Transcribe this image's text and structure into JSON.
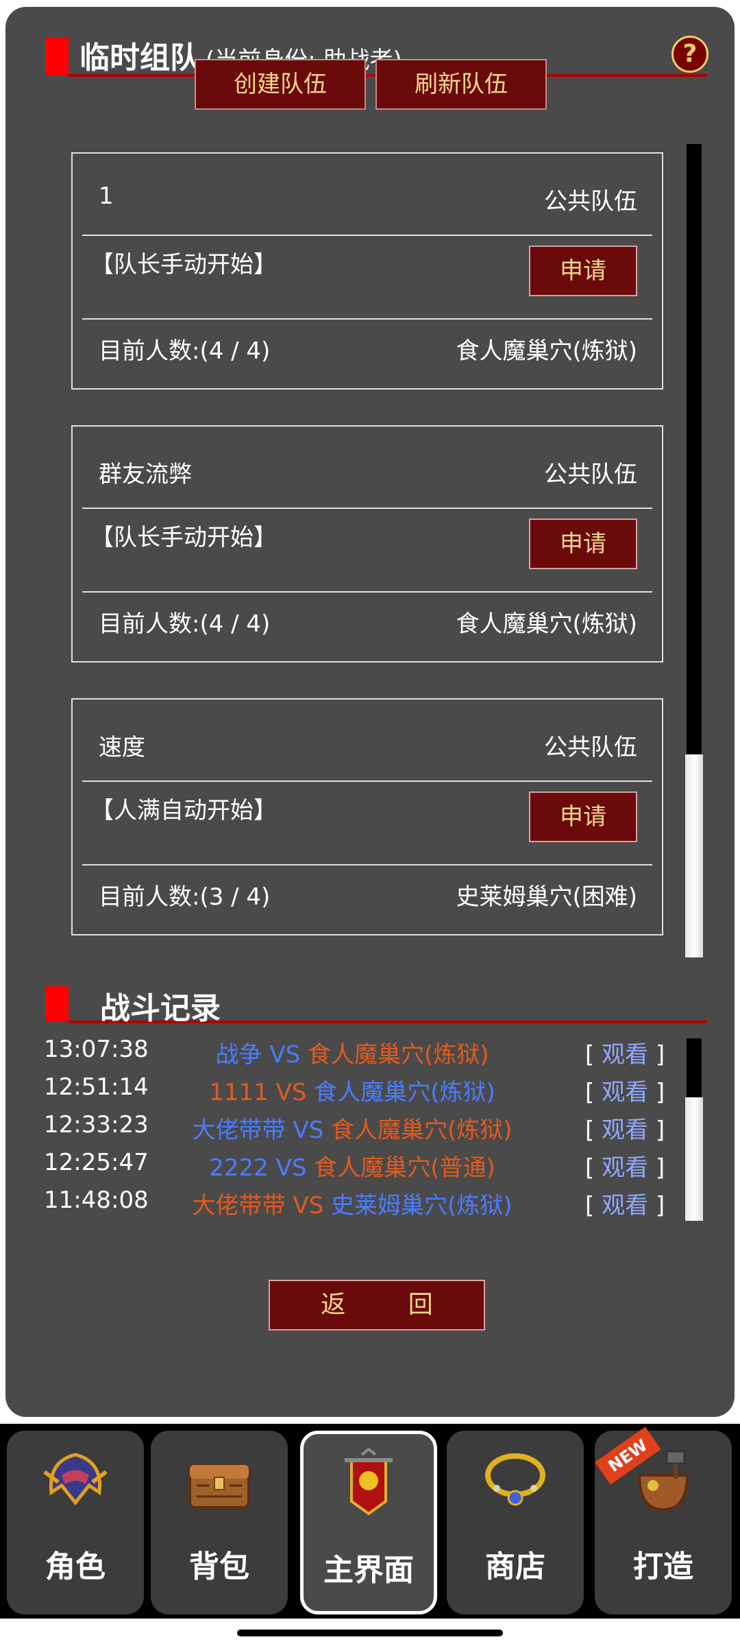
{
  "header": {
    "title": "临时组队",
    "subtitle": "(当前身份: 助战者)",
    "help": "?"
  },
  "actions": {
    "create": "创建队伍",
    "refresh": "刷新队伍"
  },
  "teams": [
    {
      "name": "1",
      "type": "公共队伍",
      "mode": "【队长手动开始】",
      "apply": "申请",
      "count": "目前人数:(4 / 4)",
      "dungeon": "食人魔巢穴(炼狱)"
    },
    {
      "name": "群友流弊",
      "type": "公共队伍",
      "mode": "【队长手动开始】",
      "apply": "申请",
      "count": "目前人数:(4 / 4)",
      "dungeon": "食人魔巢穴(炼狱)"
    },
    {
      "name": "速度",
      "type": "公共队伍",
      "mode": "【人满自动开始】",
      "apply": "申请",
      "count": "目前人数:(3 / 4)",
      "dungeon": "史莱姆巢穴(困难)"
    }
  ],
  "battle_log": {
    "title": "战斗记录",
    "rows": [
      {
        "time": "13:07:38",
        "left": "战争",
        "left_color": "blue",
        "vs": "VS",
        "right": "食人魔巢穴(炼狱)",
        "right_color": "orange",
        "watch": "观看"
      },
      {
        "time": "12:51:14",
        "left": "1111",
        "left_color": "orange",
        "vs": "VS",
        "right": "食人魔巢穴(炼狱)",
        "right_color": "blue",
        "watch": "观看"
      },
      {
        "time": "12:33:23",
        "left": "大佬带带",
        "left_color": "blue",
        "vs": "VS",
        "right": "食人魔巢穴(炼狱)",
        "right_color": "orange",
        "watch": "观看"
      },
      {
        "time": "12:25:47",
        "left": "2222",
        "left_color": "blue",
        "vs": "VS",
        "right": "食人魔巢穴(普通)",
        "right_color": "orange",
        "watch": "观看"
      },
      {
        "time": "11:48:08",
        "left": "大佬带带",
        "left_color": "orange",
        "vs": "VS",
        "right": "史莱姆巢穴(炼狱)",
        "right_color": "blue",
        "watch": "观看"
      }
    ]
  },
  "back_label": "返 回",
  "tabs": [
    {
      "label": "角色",
      "icon": "helmet-icon"
    },
    {
      "label": "背包",
      "icon": "chest-icon"
    },
    {
      "label": "主界面",
      "icon": "banner-icon",
      "active": true
    },
    {
      "label": "商店",
      "icon": "necklace-icon"
    },
    {
      "label": "打造",
      "icon": "crafting-bag-icon",
      "badge": "NEW"
    }
  ],
  "colors": {
    "blue": "#4b7cff",
    "orange": "#e35a1e",
    "accent_red": "#ff0000",
    "button_bg": "#6b0a0a",
    "button_text": "#f3d98c"
  }
}
